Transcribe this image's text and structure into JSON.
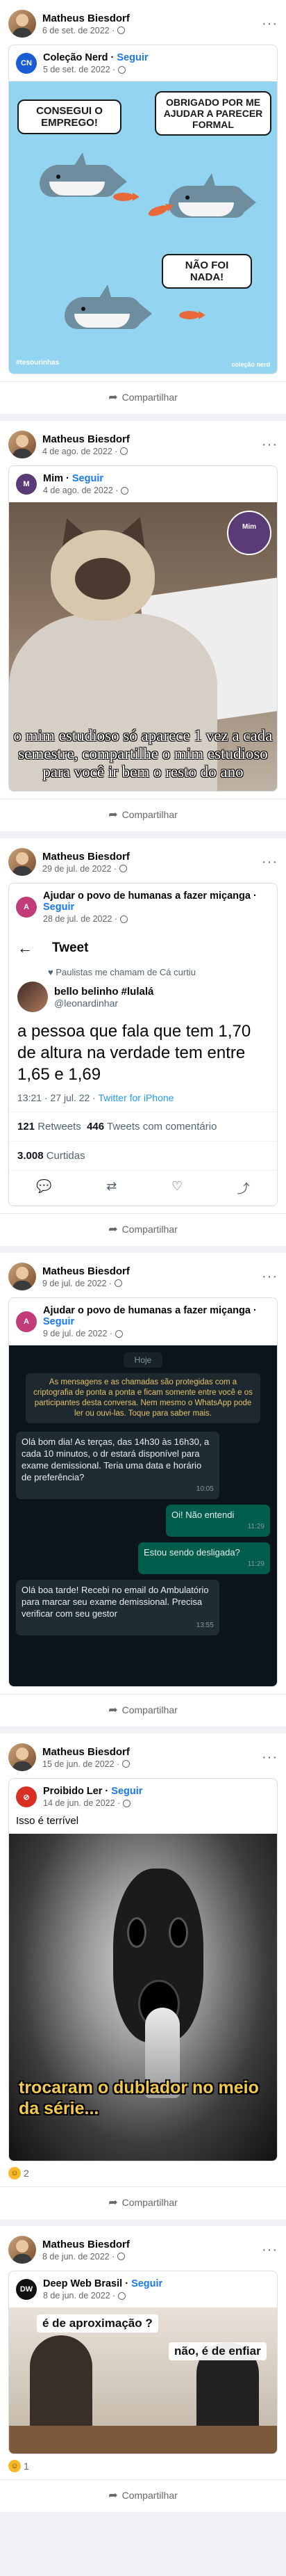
{
  "posts": [
    {
      "author": "Matheus Biesdorf",
      "date": "6 de set. de 2022 ·",
      "shared": {
        "page": "Coleção Nerd",
        "follow": "Seguir",
        "date": "5 de set. de 2022 ·",
        "caption": "",
        "meme": {
          "bubble1": "CONSEGUI O EMPREGO!",
          "bubble2": "OBRIGADO POR ME AJUDAR A PARECER FORMAL",
          "bubble3": "NÃO FOI NADA!",
          "tag": "#tesourinhas",
          "logo": "coleção nerd"
        }
      },
      "share_label": "Compartilhar"
    },
    {
      "author": "Matheus Biesdorf",
      "date": "4 de ago. de 2022 ·",
      "shared": {
        "page": "Mim",
        "follow": "Seguir",
        "date": "4 de ago. de 2022 ·",
        "caption": "",
        "meme": {
          "caption": "o mim estudioso só aparece 1 vez a cada semestre, compartilhe o mim estudioso para você ir bem o resto do ano",
          "badge": "Mim"
        }
      },
      "share_label": "Compartilhar"
    },
    {
      "author": "Matheus Biesdorf",
      "date": "29 de jul. de 2022 ·",
      "shared": {
        "page": "Ajudar o povo de humanas a fazer miçanga",
        "follow": "Seguir",
        "date": "28 de jul. de 2022 ·",
        "caption": ""
      },
      "tweet": {
        "header": "Tweet",
        "liked_by": "Paulistas me chamam de Cá curtiu",
        "name": "bello belinho #lulalá",
        "handle": "@leonardinhar",
        "text": "a pessoa que fala que tem 1,70 de altura na verdade tem entre 1,65 e 1,69",
        "time": "13:21 · 27 jul. 22 ·",
        "client": "Twitter for iPhone",
        "retweets": "121",
        "retweets_label": "Retweets",
        "quotes": "446",
        "quotes_label": "Tweets com comentário",
        "likes": "3.008",
        "likes_label": "Curtidas"
      },
      "share_label": "Compartilhar"
    },
    {
      "author": "Matheus Biesdorf",
      "date": "9 de jul. de 2022 ·",
      "shared": {
        "page": "Ajudar o povo de humanas a fazer miçanga",
        "follow": "Seguir",
        "date": "9 de jul. de 2022 ·",
        "caption": ""
      },
      "chat": {
        "day": "Hoje",
        "encryption": "As mensagens e as chamadas são protegidas com a criptografia de ponta a ponta e ficam somente entre você e os participantes desta conversa. Nem mesmo o WhatsApp pode ler ou ouvi-las. Toque para saber mais.",
        "messages": [
          {
            "dir": "in",
            "text": "Olá bom dia! As terças, das 14h30 às 16h30, a cada 10 minutos, o dr estará disponível para exame demissional. Teria uma data e horário de preferência?",
            "time": "10:05"
          },
          {
            "dir": "out",
            "text": "Oi! Não entendi",
            "time": "11:29"
          },
          {
            "dir": "out",
            "text": "Estou sendo desligada?",
            "time": "11:29"
          },
          {
            "dir": "in",
            "text": "Olá boa tarde! Recebi no email do Ambulatório para marcar seu exame demissional. Precisa verificar com seu gestor",
            "time": "13:55"
          }
        ]
      },
      "share_label": "Compartilhar"
    },
    {
      "author": "Matheus Biesdorf",
      "date": "15 de jun. de 2022 ·",
      "shared": {
        "page": "Proibido Ler",
        "follow": "Seguir",
        "date": "14 de jun. de 2022 ·",
        "caption": "Isso é terrível",
        "meme": {
          "caption": "trocaram o dublador no meio da série..."
        }
      },
      "reactions": "2",
      "share_label": "Compartilhar"
    },
    {
      "author": "Matheus Biesdorf",
      "date": "8 de jun. de 2022 ·",
      "shared": {
        "page": "Deep Web Brasil",
        "follow": "Seguir",
        "date": "8 de jun. de 2022 ·",
        "caption": "",
        "meme": {
          "caption1": "é de aproximação ?",
          "caption2": "não, é de enfiar"
        }
      },
      "reactions": "1",
      "share_label": "Compartilhar"
    }
  ],
  "colors": {
    "link": "#1877f2",
    "bg": "#f0f2f5"
  }
}
